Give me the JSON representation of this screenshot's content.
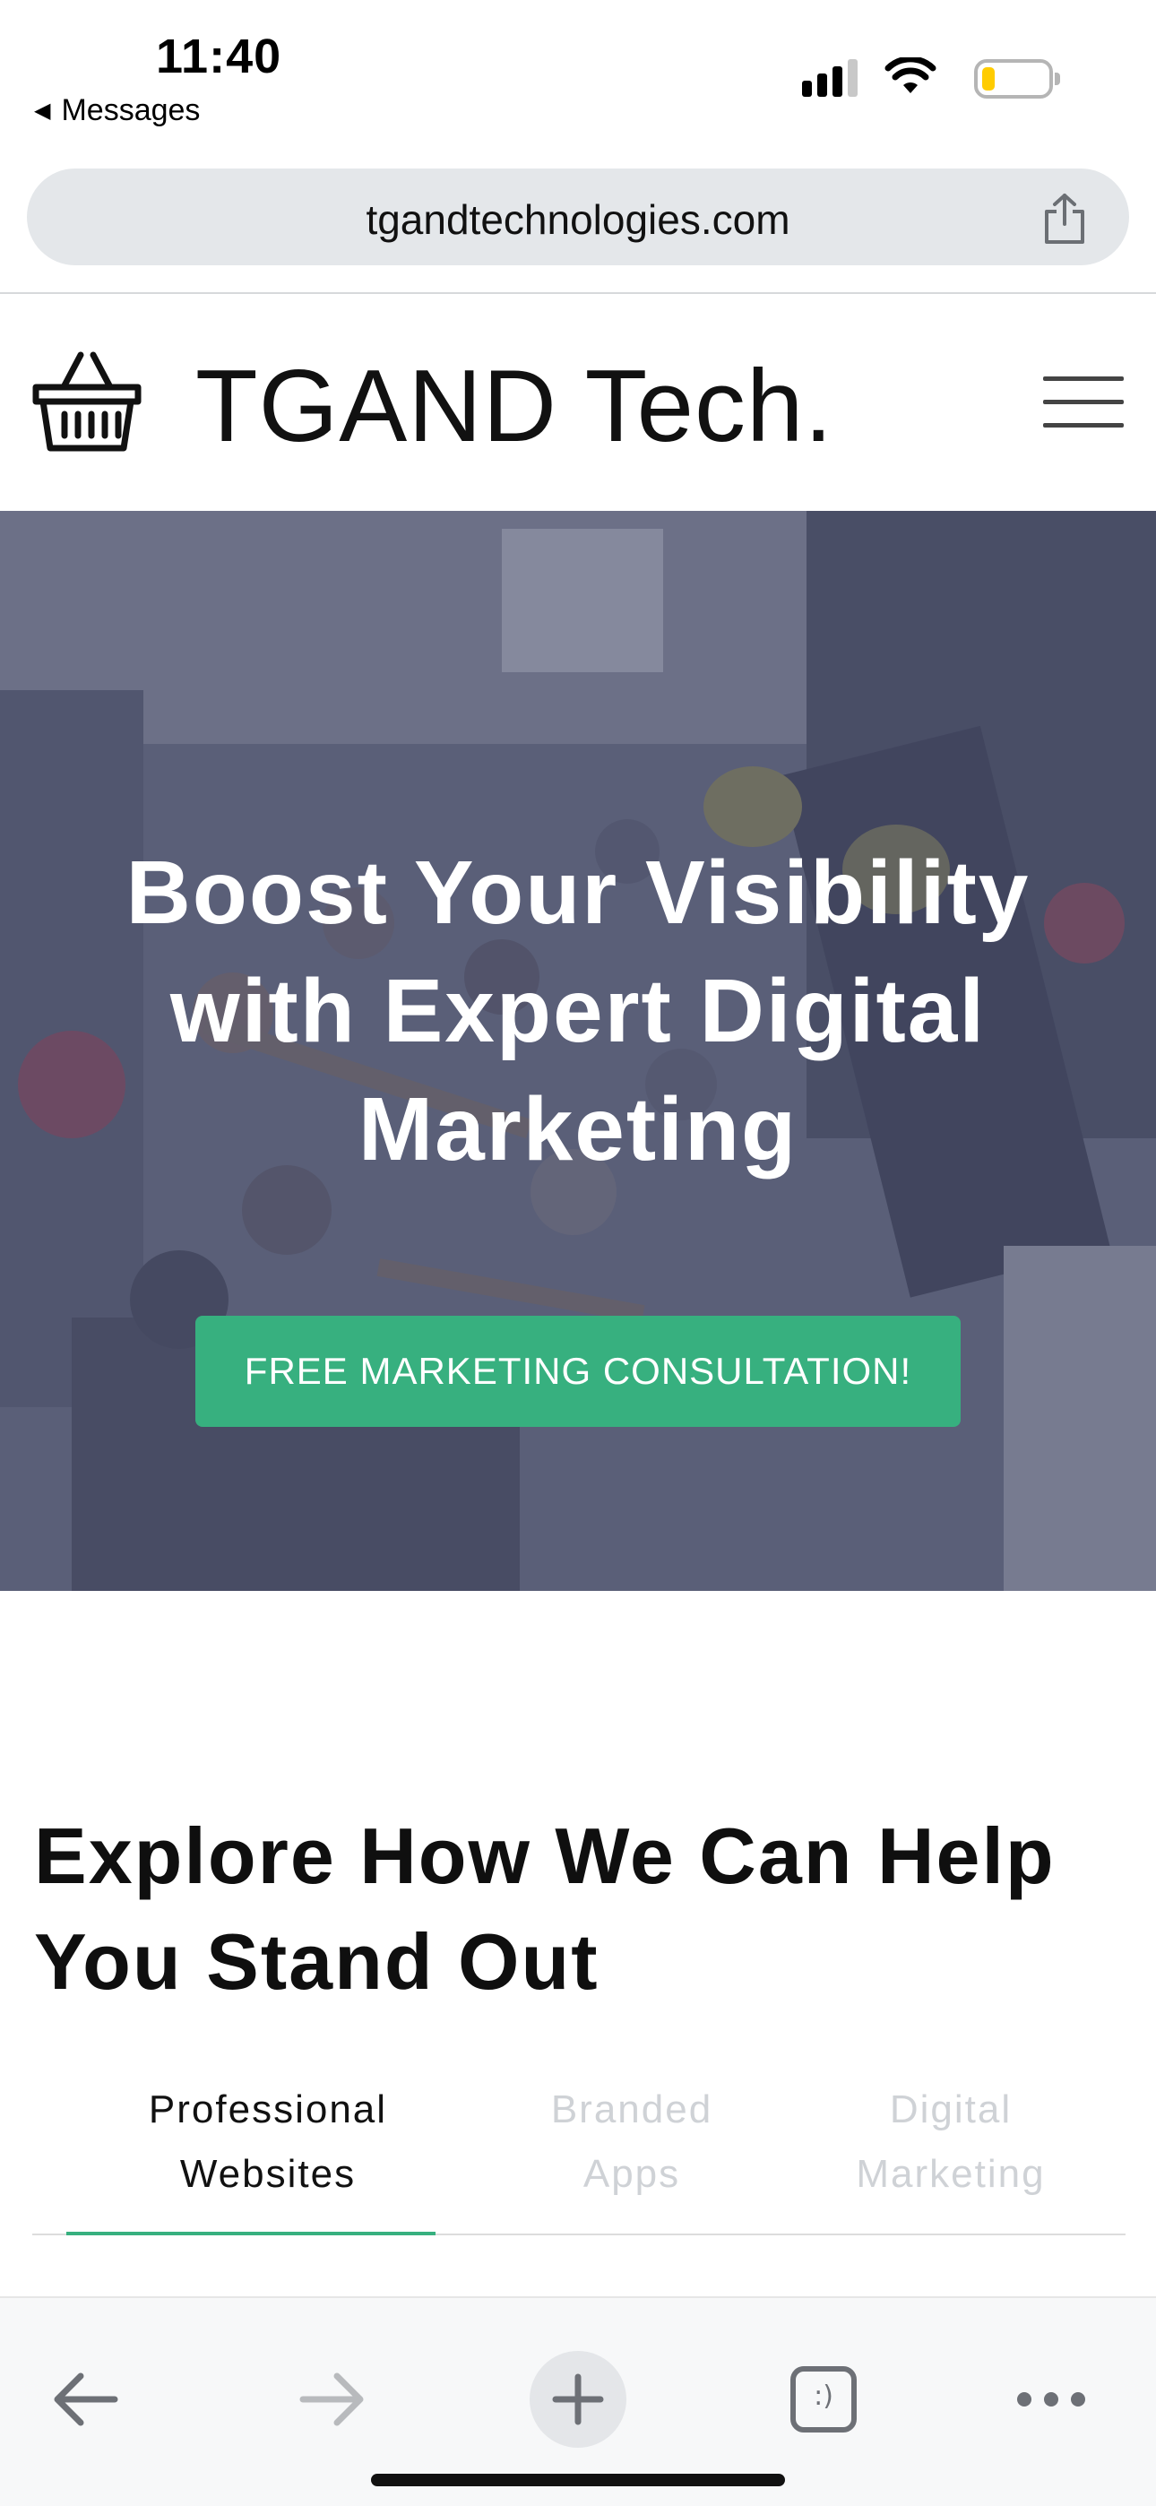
{
  "status_bar": {
    "time": "11:40",
    "back_app": "Messages",
    "battery_color": "#ffcc00"
  },
  "browser": {
    "url": "tgandtechnologies.com",
    "share_icon": "share-icon"
  },
  "site": {
    "brand": "TGAND Tech.",
    "logo_icon": "shopping-basket-icon",
    "menu_icon": "hamburger-menu-icon"
  },
  "hero": {
    "title": "Boost Your Visibility with Expert Digital Marketing",
    "cta_label": "FREE MARKETING CONSULTATION!",
    "cta_color": "#37b07f"
  },
  "explore": {
    "title": "Explore How We Can Help You Stand Out",
    "tabs": [
      {
        "label": "Professional Websites",
        "active": true
      },
      {
        "label": "Branded Apps",
        "active": false
      },
      {
        "label": "Digital Marketing",
        "active": false
      }
    ]
  },
  "toolbar": {
    "items": [
      "back-arrow-icon",
      "forward-arrow-icon",
      "new-tab-plus-icon",
      "tabs-switcher-icon",
      "more-options-icon"
    ],
    "tab_switcher_glyph": ":)"
  }
}
